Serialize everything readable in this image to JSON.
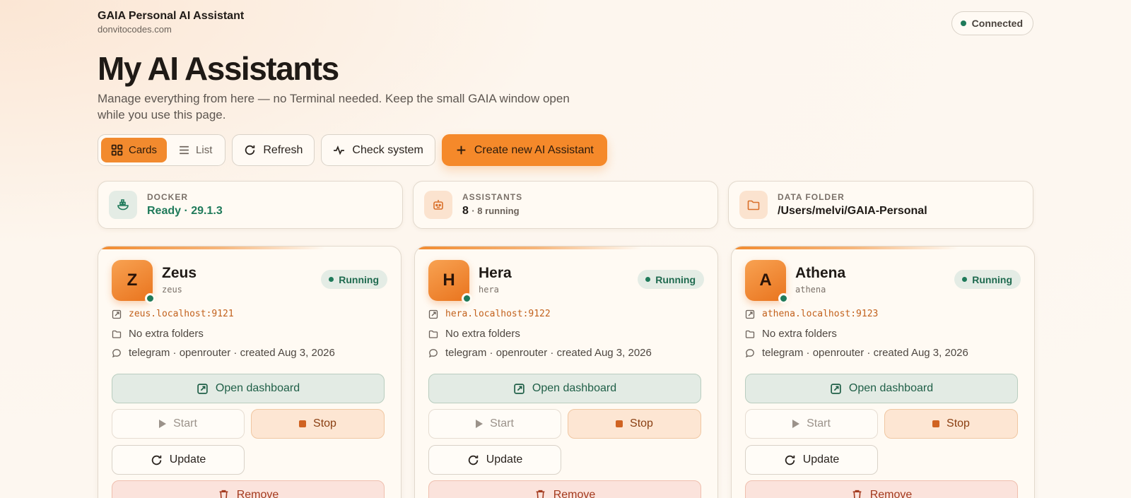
{
  "header": {
    "app_title": "GAIA Personal AI Assistant",
    "app_subtitle": "donvitocodes.com",
    "connection_status": "Connected"
  },
  "page": {
    "title": "My AI Assistants",
    "intro": "Manage everything from here — no Terminal needed. Keep the small GAIA window open while you use this page."
  },
  "toolbar": {
    "view_cards": "Cards",
    "view_list": "List",
    "refresh": "Refresh",
    "check_system": "Check system",
    "create": "Create new AI Assistant",
    "active_view": "Cards"
  },
  "stats": {
    "docker": {
      "label": "DOCKER",
      "value": "Ready · 29.1.3",
      "icon": "docker-whale-icon"
    },
    "assistants": {
      "label": "ASSISTANTS",
      "count": "8",
      "detail": "· 8 running",
      "icon": "robot-icon"
    },
    "data_folder": {
      "label": "DATA FOLDER",
      "value": "/Users/melvi/GAIA-Personal",
      "icon": "folder-icon"
    }
  },
  "assistants": [
    {
      "initial": "Z",
      "name": "Zeus",
      "slug": "zeus",
      "status": "Running",
      "url": "zeus.localhost:9121",
      "folders": "No extra folders",
      "channel": "telegram · openrouter · created Aug 3, 2026"
    },
    {
      "initial": "H",
      "name": "Hera",
      "slug": "hera",
      "status": "Running",
      "url": "hera.localhost:9122",
      "folders": "No extra folders",
      "channel": "telegram · openrouter · created Aug 3, 2026"
    },
    {
      "initial": "A",
      "name": "Athena",
      "slug": "athena",
      "status": "Running",
      "url": "athena.localhost:9123",
      "folders": "No extra folders",
      "channel": "telegram · openrouter · created Aug 3, 2026"
    }
  ],
  "card_actions": {
    "open_dashboard": "Open dashboard",
    "start": "Start",
    "stop": "Stop",
    "update": "Update",
    "remove": "Remove"
  },
  "colors": {
    "accent": "#f5892a",
    "running_green": "#1f7a5a",
    "link_orange": "#c2611c"
  }
}
